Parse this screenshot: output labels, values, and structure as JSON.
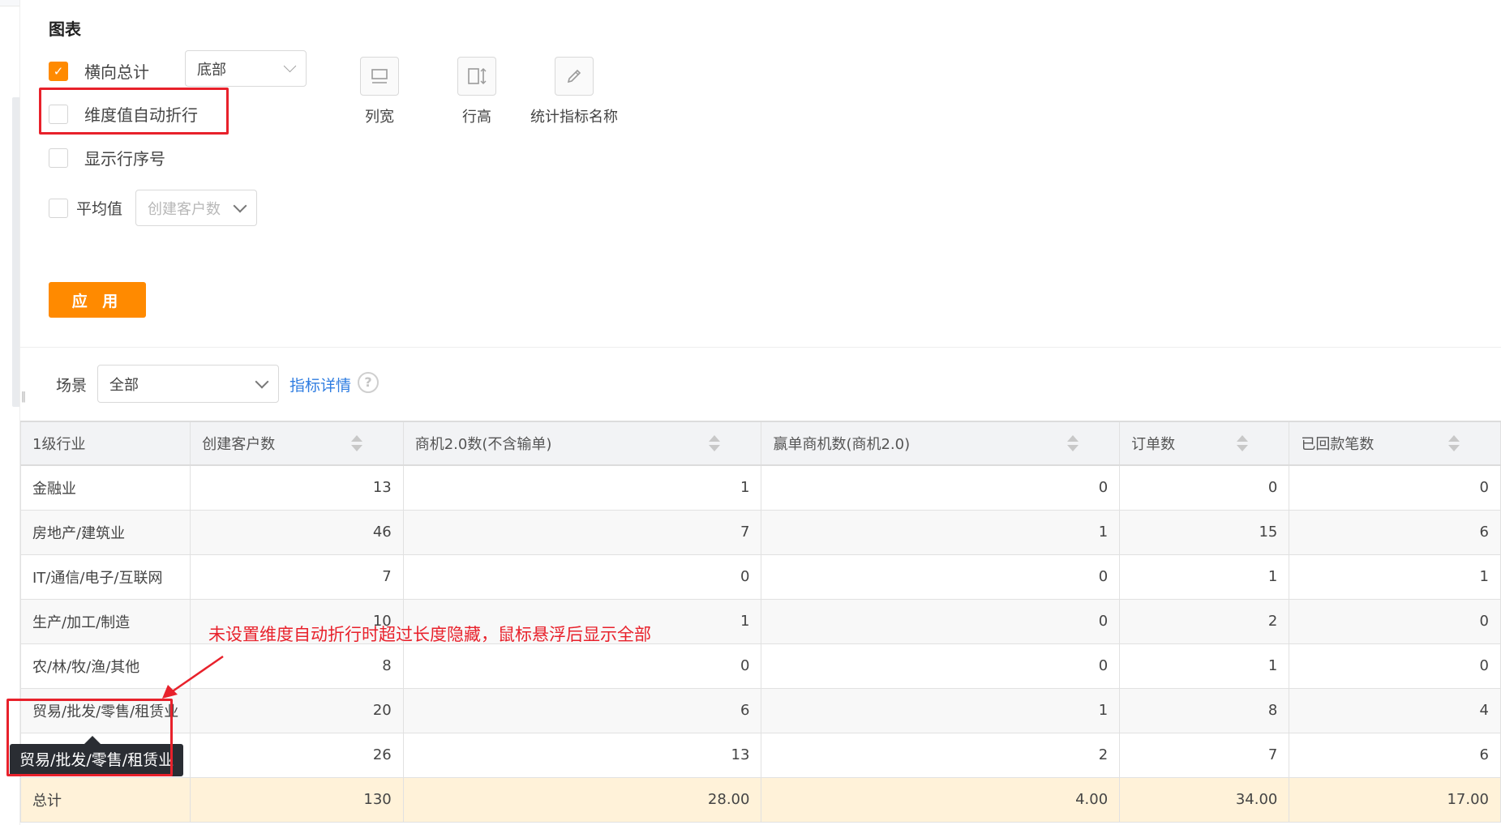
{
  "section_title": "图表",
  "options": {
    "horizontal_total": {
      "label": "横向总计",
      "checked": true,
      "position_select": "底部"
    },
    "auto_wrap": {
      "label": "维度值自动折行",
      "checked": false
    },
    "show_row_number": {
      "label": "显示行序号",
      "checked": false
    },
    "average": {
      "label": "平均值",
      "checked": false,
      "metric_placeholder": "创建客户数"
    }
  },
  "tools": {
    "column_width": {
      "label": "列宽",
      "icon": "column-width-icon"
    },
    "row_height": {
      "label": "行高",
      "icon": "row-height-icon"
    },
    "metric_name": {
      "label": "统计指标名称",
      "icon": "pencil-icon"
    }
  },
  "apply_label": "应 用",
  "scene": {
    "label": "场景",
    "value": "全部",
    "detail_link": "指标详情",
    "help_icon": "question-icon"
  },
  "table": {
    "headers": [
      "1级行业",
      "创建客户数",
      "商机2.0数(不含输单)",
      "赢单商机数(商机2.0)",
      "订单数",
      "已回款笔数"
    ],
    "rows": [
      [
        "金融业",
        "13",
        "1",
        "0",
        "0",
        "0"
      ],
      [
        "房地产/建筑业",
        "46",
        "7",
        "1",
        "15",
        "6"
      ],
      [
        "IT/通信/电子/互联网",
        "7",
        "0",
        "0",
        "1",
        "1"
      ],
      [
        "生产/加工/制造",
        "10",
        "1",
        "0",
        "2",
        "0"
      ],
      [
        "农/林/牧/渔/其他",
        "8",
        "0",
        "0",
        "1",
        "0"
      ],
      [
        "贸易/批发/零售/租赁业",
        "20",
        "6",
        "1",
        "8",
        "4"
      ],
      [
        "",
        "26",
        "13",
        "2",
        "7",
        "6"
      ]
    ],
    "total": [
      "总计",
      "130",
      "28.00",
      "4.00",
      "34.00",
      "17.00"
    ]
  },
  "tooltip_text": "贸易/批发/零售/租赁业",
  "annotation": "未设置维度自动折行时超过长度隐藏，鼠标悬浮后显示全部",
  "colors": {
    "accent": "#ff8a00",
    "highlight": "#e8212b",
    "link": "#2f7de1",
    "total_row": "#fff2d9"
  }
}
